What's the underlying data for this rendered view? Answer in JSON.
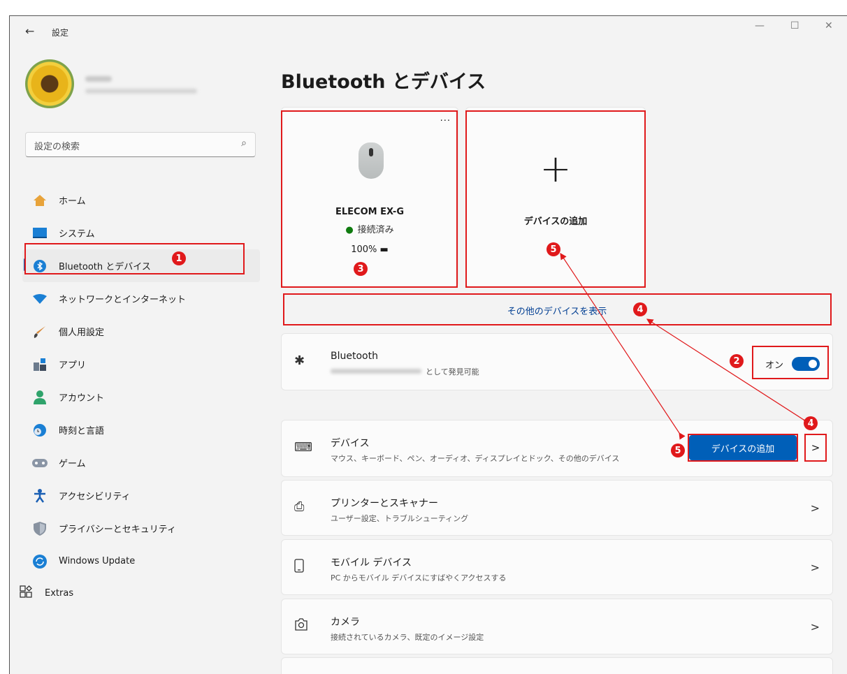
{
  "window": {
    "title": "設定",
    "back": "←",
    "minimize": "—",
    "maximize": "☐",
    "close": "✕"
  },
  "search": {
    "placeholder": "設定の検索",
    "icon": "⌕"
  },
  "nav": [
    {
      "label": "ホーム",
      "icon": "home-icon"
    },
    {
      "label": "システム",
      "icon": "system-icon"
    },
    {
      "label": "Bluetooth とデバイス",
      "icon": "bluetooth-icon",
      "selected": true
    },
    {
      "label": "ネットワークとインターネット",
      "icon": "wifi-icon"
    },
    {
      "label": "個人用設定",
      "icon": "brush-icon"
    },
    {
      "label": "アプリ",
      "icon": "apps-icon"
    },
    {
      "label": "アカウント",
      "icon": "account-icon"
    },
    {
      "label": "時刻と言語",
      "icon": "globe-clock-icon"
    },
    {
      "label": "ゲーム",
      "icon": "gamepad-icon"
    },
    {
      "label": "アクセシビリティ",
      "icon": "accessibility-icon"
    },
    {
      "label": "プライバシーとセキュリティ",
      "icon": "shield-icon"
    },
    {
      "label": "Windows Update",
      "icon": "update-icon"
    }
  ],
  "extras": {
    "label": "Extras"
  },
  "page": {
    "title": "Bluetooth とデバイス"
  },
  "device_card": {
    "name": "ELECOM EX-G",
    "status": "接続済み",
    "battery": "100%",
    "more": "···"
  },
  "add_card": {
    "plus": "+",
    "label": "デバイスの追加"
  },
  "show_more": "その他のデバイスを表示",
  "bluetooth_row": {
    "title": "Bluetooth",
    "subtitle_suffix": "として発見可能",
    "toggle_label": "オン",
    "toggle_on": true
  },
  "rows": [
    {
      "title": "デバイス",
      "subtitle": "マウス、キーボード、ペン、オーディオ、ディスプレイとドック、その他のデバイス",
      "button": "デバイスの追加",
      "chevron": ">"
    },
    {
      "title": "プリンターとスキャナー",
      "subtitle": "ユーザー設定、トラブルシューティング",
      "chevron": ">"
    },
    {
      "title": "モバイル デバイス",
      "subtitle": "PC からモバイル デバイスにすばやくアクセスする",
      "chevron": ">"
    },
    {
      "title": "カメラ",
      "subtitle": "接続されているカメラ、既定のイメージ設定",
      "chevron": ">"
    }
  ],
  "annotations": {
    "n1": "1",
    "n2": "2",
    "n3": "3",
    "n4": "4",
    "n5": "5"
  },
  "colors": {
    "accent": "#005fb8",
    "annotation": "#e0191b",
    "connected": "#0f7b0f"
  }
}
